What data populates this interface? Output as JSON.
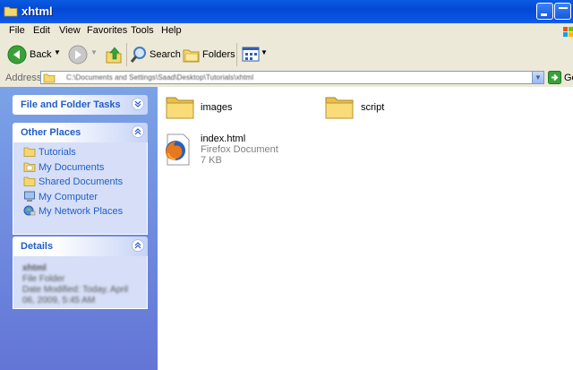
{
  "window": {
    "title": "xhtml"
  },
  "menu": [
    "File",
    "Edit",
    "View",
    "Favorites",
    "Tools",
    "Help"
  ],
  "toolbar": {
    "back": "Back",
    "search": "Search",
    "folders": "Folders"
  },
  "address": {
    "label": "Address",
    "value": "C:\\Documents and Settings\\Saad\\Desktop\\Tutorials\\xhtml",
    "go": "Go"
  },
  "sidebar": {
    "file_tasks": {
      "title": "File and Folder Tasks"
    },
    "other_places": {
      "title": "Other Places",
      "items": [
        {
          "label": "Tutorials",
          "icon": "folder-icon"
        },
        {
          "label": "My Documents",
          "icon": "folder-icon"
        },
        {
          "label": "Shared Documents",
          "icon": "folder-icon"
        },
        {
          "label": "My Computer",
          "icon": "computer-icon"
        },
        {
          "label": "My Network Places",
          "icon": "network-icon"
        }
      ]
    },
    "details": {
      "title": "Details",
      "name": "xhtml",
      "type": "File Folder",
      "modified": "Date Modified: Today, April 06, 2009, 5:45 AM"
    }
  },
  "files": [
    {
      "name": "images",
      "kind": "folder"
    },
    {
      "name": "script",
      "kind": "folder"
    },
    {
      "name": "index.html",
      "type": "Firefox Document",
      "size": "7 KB",
      "kind": "firefox-document"
    }
  ],
  "colors": {
    "title_bar": "#0a5be0",
    "sidebar": "#7ba2e7",
    "panel_title": "#215dc6",
    "chrome": "#ece9d8"
  }
}
